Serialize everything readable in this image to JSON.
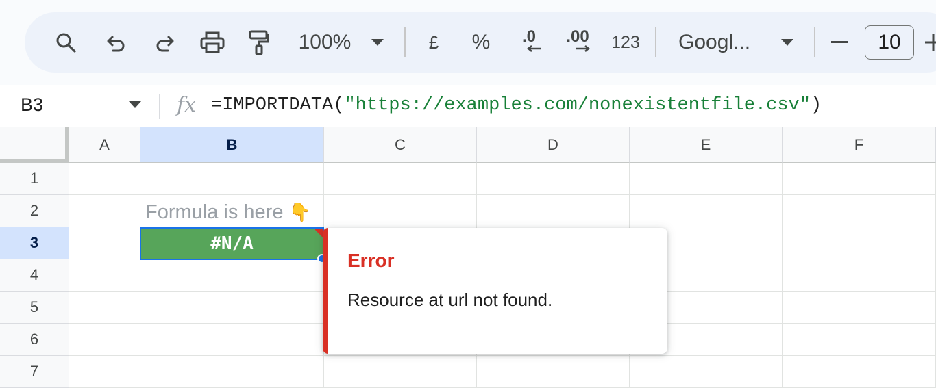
{
  "toolbar": {
    "zoom": "100%",
    "currency_label": "£",
    "percent_label": "%",
    "decrease_decimal_label": ".0",
    "increase_decimal_label": ".00",
    "more_formats_label": "123",
    "font_name": "Googl...",
    "font_size": "10",
    "icons": [
      "search-icon",
      "undo-icon",
      "redo-icon",
      "print-icon",
      "paint-format-icon",
      "chevron-down-icon",
      "minus-icon",
      "plus-icon"
    ]
  },
  "formula_bar": {
    "cell_ref": "B3",
    "fx_label": "fx",
    "formula_prefix": "=IMPORTDATA(",
    "formula_string": "\"https://examples.com/nonexistentfile.csv\"",
    "formula_suffix": ")"
  },
  "grid": {
    "columns": [
      "A",
      "B",
      "C",
      "D",
      "E",
      "F"
    ],
    "rows": [
      "1",
      "2",
      "3",
      "4",
      "5",
      "6",
      "7"
    ],
    "active_column": "B",
    "active_row": "3",
    "b2_text": "Formula is here",
    "b2_emoji": "👇",
    "b3_value": "#N/A"
  },
  "error_popup": {
    "title": "Error",
    "message": "Resource at url not found."
  },
  "colors": {
    "toolbar_bg": "#edf2fa",
    "selected_header": "#d3e3fd",
    "cell_fill": "#57a55a",
    "selection_border": "#1a73e8",
    "error_red": "#d93025",
    "formula_string": "#188038"
  }
}
